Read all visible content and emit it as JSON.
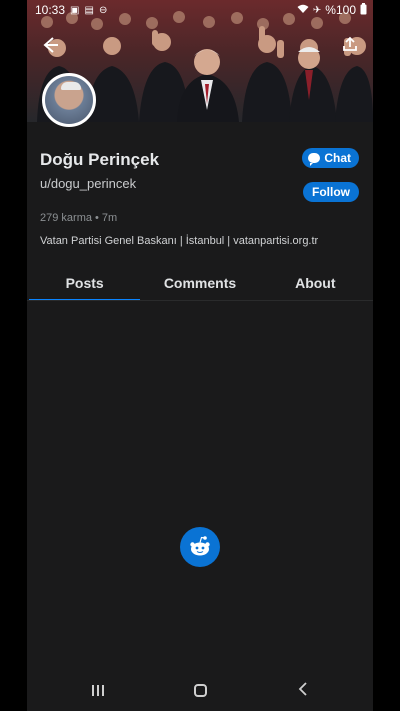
{
  "status_bar": {
    "time": "10:33",
    "battery": "%100",
    "icons": [
      "photo-icon",
      "image-icon",
      "circle-icon",
      "wifi-icon",
      "airplane-icon",
      "battery-icon"
    ]
  },
  "profile": {
    "display_name": "Doğu Perinçek",
    "username": "u/dogu_perincek",
    "karma_meta": "279 karma • 7m",
    "bio": "Vatan Partisi Genel Baskanı | İstanbul | vatanpartisi.org.tr"
  },
  "actions": {
    "chat_label": "Chat",
    "follow_label": "Follow"
  },
  "tabs": [
    {
      "label": "Posts",
      "active": true
    },
    {
      "label": "Comments",
      "active": false
    },
    {
      "label": "About",
      "active": false
    }
  ],
  "colors": {
    "accent": "#0a73d4",
    "background": "#1a1a1b",
    "tab_underline": "#0a84ff"
  }
}
